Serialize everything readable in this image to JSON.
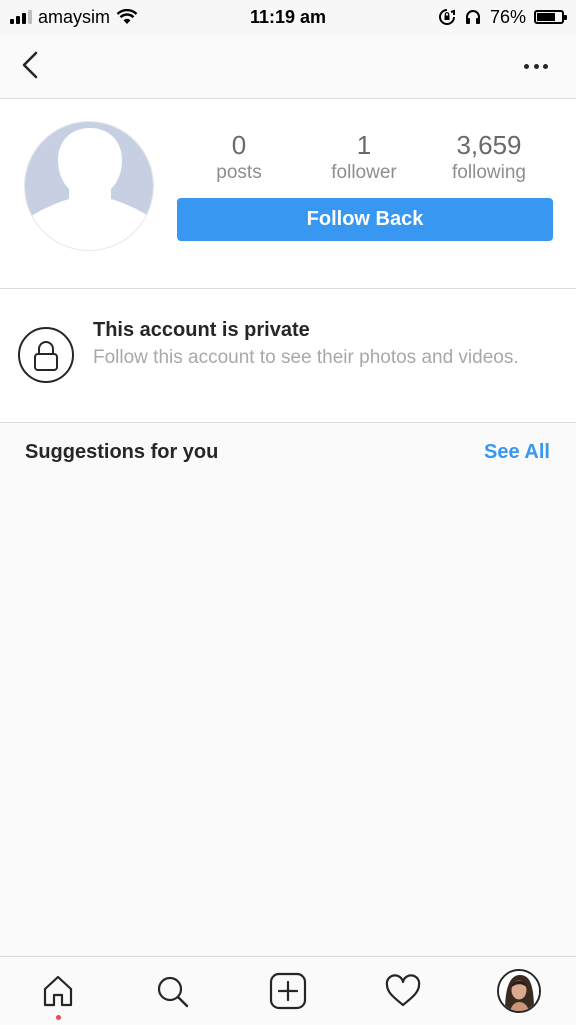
{
  "status_bar": {
    "carrier": "amaysim",
    "time": "11:19 am",
    "battery_percent": "76%",
    "battery_level": 0.76,
    "icons": [
      "signal-icon",
      "wifi-icon",
      "orientation-lock-icon",
      "headphones-icon",
      "battery-icon"
    ]
  },
  "nav": {
    "icons": [
      "back-arrow-icon",
      "more-options-icon"
    ]
  },
  "profile": {
    "stats": [
      {
        "value": "0",
        "label": "posts"
      },
      {
        "value": "1",
        "label": "follower"
      },
      {
        "value": "3,659",
        "label": "following"
      }
    ],
    "follow_button_label": "Follow Back"
  },
  "private_notice": {
    "title": "This account is private",
    "description": "Follow this account to see their photos and videos."
  },
  "suggestions": {
    "title": "Suggestions for you",
    "see_all_label": "See All"
  },
  "tab_bar": {
    "tabs": [
      "home-icon",
      "search-icon",
      "add-post-icon",
      "activity-heart-icon",
      "profile-avatar"
    ]
  },
  "colors": {
    "accent": "#3897f0",
    "avatar_placeholder": "#c7cfe2",
    "notification_dot": "#ed4956",
    "background": "#fafafa"
  }
}
